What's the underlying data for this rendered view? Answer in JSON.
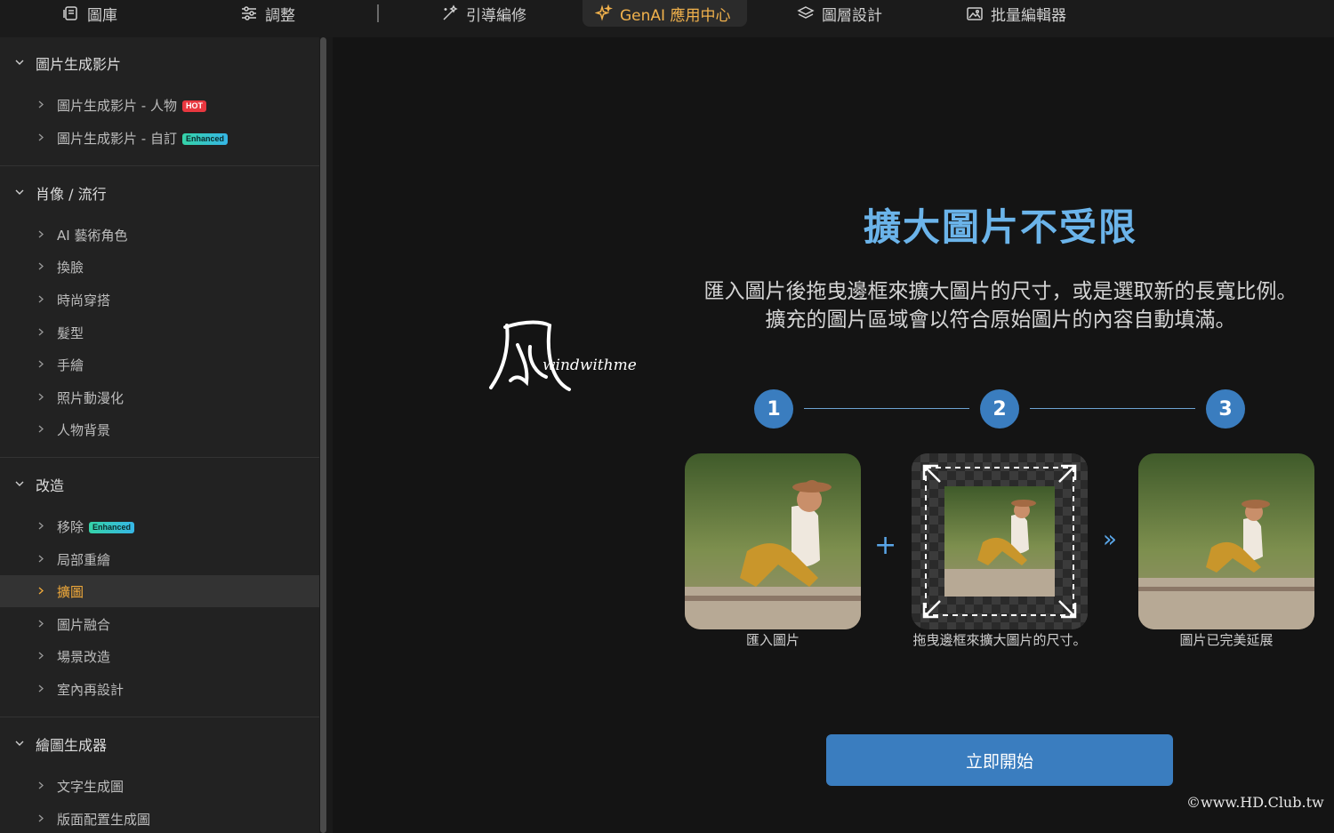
{
  "tabs": [
    {
      "label": "圖庫",
      "icon": "library-icon"
    },
    {
      "label": "調整",
      "icon": "sliders-icon"
    },
    {
      "label": "引導編修",
      "icon": "magic-wand-icon"
    },
    {
      "label": "GenAI 應用中心",
      "icon": "sparkle-icon",
      "active": true
    },
    {
      "label": "圖層設計",
      "icon": "layers-icon"
    },
    {
      "label": "批量編輯器",
      "icon": "batch-images-icon"
    }
  ],
  "sidebar": {
    "sections": [
      {
        "title": "圖片生成影片",
        "items": [
          {
            "label": "圖片生成影片 - 人物",
            "badge": "HOT"
          },
          {
            "label": "圖片生成影片 - 自訂",
            "badge": "Enhanced"
          }
        ]
      },
      {
        "title": "肖像 / 流行",
        "items": [
          {
            "label": "AI 藝術角色"
          },
          {
            "label": "換臉"
          },
          {
            "label": "時尚穿搭"
          },
          {
            "label": "髮型"
          },
          {
            "label": "手繪"
          },
          {
            "label": "照片動漫化"
          },
          {
            "label": "人物背景"
          }
        ]
      },
      {
        "title": "改造",
        "items": [
          {
            "label": "移除",
            "badge": "Enhanced"
          },
          {
            "label": "局部重繪"
          },
          {
            "label": "擴圖",
            "selected": true
          },
          {
            "label": "圖片融合"
          },
          {
            "label": "場景改造"
          },
          {
            "label": "室內再設計"
          }
        ]
      },
      {
        "title": "繪圖生成器",
        "items": [
          {
            "label": "文字生成圖"
          },
          {
            "label": "版面配置生成圖"
          }
        ]
      }
    ]
  },
  "main": {
    "title": "擴大圖片不受限",
    "description_line1": "匯入圖片後拖曳邊框來擴大圖片的尺寸，或是選取新的長寬比例。",
    "description_line2": "擴充的圖片區域會以符合原始圖片的內容自動填滿。",
    "steps": [
      {
        "number": "1",
        "caption": "匯入圖片"
      },
      {
        "number": "2",
        "caption": "拖曳邊框來擴大圖片的尺寸。"
      },
      {
        "number": "3",
        "caption": "圖片已完美延展"
      }
    ],
    "plus_symbol": "+",
    "arrows_symbol": "»",
    "start_button": "立即開始"
  },
  "watermark": {
    "logo_text": "windwithme",
    "copyright": "©www.HD.Club.tw"
  },
  "colors": {
    "accent_blue": "#3a7dbf",
    "title_blue": "#6bb4ea",
    "active_tab": "#f2b24c",
    "selected_item": "#f0a93a"
  }
}
